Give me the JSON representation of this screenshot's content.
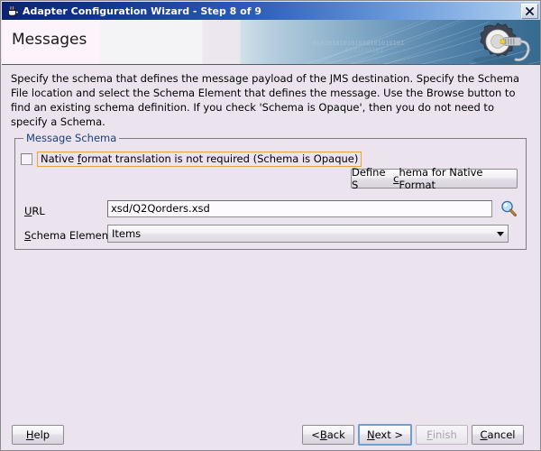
{
  "window": {
    "title": "Adapter Configuration Wizard - Step 8 of 9",
    "app_icon": "java-coffee-cup-icon",
    "close_label": "✕"
  },
  "banner": {
    "heading": "Messages",
    "binary_line1": "010101010101010101010101",
    "binary_line2": "0101010101",
    "gear_icon": "gear-wrench-icon"
  },
  "description": {
    "text": "Specify the schema that defines the message payload of the JMS destination.  Specify the Schema File location and select the Schema Element that defines the message. Use the Browse button to find an existing schema definition. If you check 'Schema is Opaque', then you do not need to specify a Schema."
  },
  "group": {
    "legend": "Message Schema",
    "opaque_checkbox": {
      "label_pre": "Native ",
      "label_mnemonic": "f",
      "label_post": "ormat translation is not required (Schema is Opaque)",
      "checked": false
    },
    "define_schema_button": {
      "label_pre": "Define S",
      "label_mnemonic": "c",
      "label_post": "hema for Native Format"
    },
    "url_field": {
      "label_mnemonic": "U",
      "label_post": "RL",
      "value": "xsd/Q2Qorders.xsd",
      "browse_icon": "magnifier-icon"
    },
    "schema_element_field": {
      "label_mnemonic": "S",
      "label_post": "chema Element",
      "value": "Items",
      "arrow_icon": "chevron-down-icon"
    }
  },
  "footer": {
    "help": {
      "pre": "",
      "mnemonic": "H",
      "post": "elp",
      "enabled": true,
      "focused": false
    },
    "back": {
      "pre": "< ",
      "mnemonic": "B",
      "post": "ack",
      "enabled": true,
      "focused": false
    },
    "next": {
      "pre": "",
      "mnemonic": "N",
      "post": "ext >",
      "enabled": true,
      "focused": true
    },
    "finish": {
      "pre": "",
      "mnemonic": "F",
      "post": "inish",
      "enabled": false,
      "focused": false
    },
    "cancel": {
      "pre": "",
      "mnemonic": "C",
      "post": "ancel",
      "enabled": true,
      "focused": false
    }
  },
  "colors": {
    "panel_bg": "#ebe4ee",
    "titlebar_start": "#0a2472",
    "titlebar_end": "#b9d4f0",
    "legend_text": "#1a3f7a",
    "focus_outline": "#e8a33d",
    "focus_button_border": "#6f9fd1"
  }
}
